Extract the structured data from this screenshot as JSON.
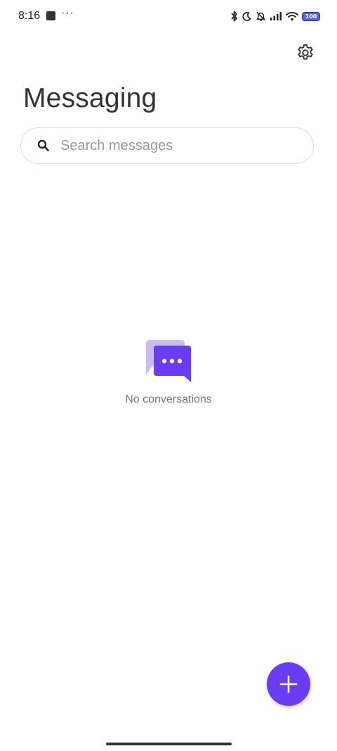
{
  "status_bar": {
    "time": "8:16",
    "more": "···",
    "battery": "100",
    "icons": [
      "bluetooth-icon",
      "moon-icon",
      "bell-off-icon",
      "signal-icon",
      "wifi-icon",
      "battery-icon"
    ]
  },
  "header": {
    "title": "Messaging",
    "settings_icon": "gear-icon"
  },
  "search": {
    "placeholder": "Search messages",
    "icon": "search-icon"
  },
  "empty_state": {
    "icon": "chat-bubbles-icon",
    "text": "No conversations"
  },
  "fab": {
    "icon": "plus-icon"
  },
  "colors": {
    "accent": "#6a3cf6",
    "accent_light": "#c9bdf9",
    "text_secondary": "#777777"
  }
}
